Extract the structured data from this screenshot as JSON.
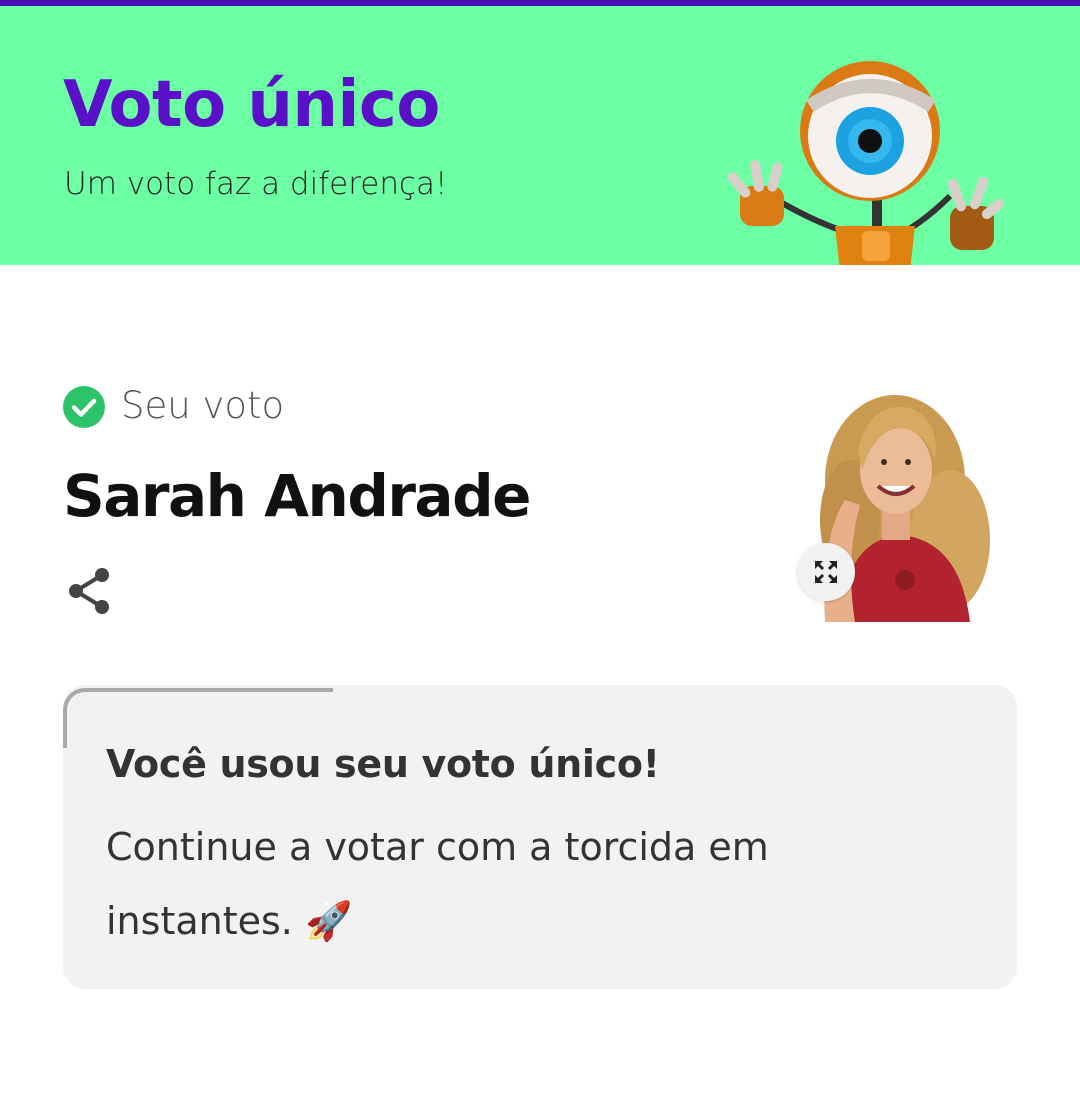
{
  "banner": {
    "title": "Voto único",
    "subtitle": "Um voto faz a diferença!",
    "background": "#6dffa3",
    "title_color": "#5a10c8",
    "stripe_color": "#4a0fb4",
    "mascot_icon": "big-brother-eye-robot"
  },
  "vote": {
    "status_icon": "check-circle-icon",
    "status_color": "#2cc36b",
    "label": "Seu voto",
    "candidate_name": "Sarah Andrade",
    "share_icon": "share-icon",
    "expand_icon": "expand-icon"
  },
  "notice": {
    "title": "Você usou seu voto único!",
    "body": "Continue a votar com a torcida em instantes. 🚀"
  }
}
